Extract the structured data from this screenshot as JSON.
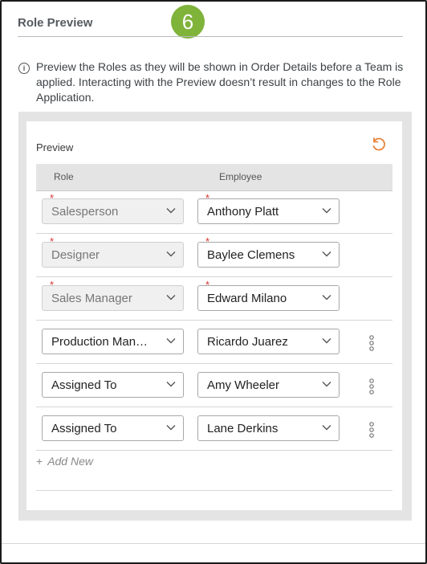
{
  "section": {
    "title": "Role Preview",
    "step_badge": "6",
    "info_text": "Preview the Roles as they will be shown in Order Details before a Team is applied. Interacting with the Preview doesn’t result in changes to the Role Application."
  },
  "preview": {
    "label": "Preview",
    "columns": {
      "role": "Role",
      "employee": "Employee"
    },
    "rows": [
      {
        "role": "Salesperson",
        "employee": "Anthony Platt",
        "required": "*",
        "role_locked": true
      },
      {
        "role": "Designer",
        "employee": "Baylee Clemens",
        "required": "*",
        "role_locked": true
      },
      {
        "role": "Sales Manager",
        "employee": "Edward Milano",
        "required": "*",
        "role_locked": true
      },
      {
        "role": "Production Man…",
        "employee": "Ricardo Juarez",
        "role_locked": false
      },
      {
        "role": "Assigned To",
        "employee": "Amy Wheeler",
        "role_locked": false
      },
      {
        "role": "Assigned To",
        "employee": "Lane Derkins",
        "role_locked": false
      }
    ],
    "add_new_label": "Add New",
    "add_new_icon": "+"
  },
  "icons": {
    "info": "info-circle-icon",
    "refresh": "refresh-icon",
    "chevron": "chevron-down-icon",
    "menu": "more-vertical-icon"
  },
  "colors": {
    "badge": "#7fb33a",
    "refresh": "#e8833a",
    "required": "#d6332f"
  }
}
